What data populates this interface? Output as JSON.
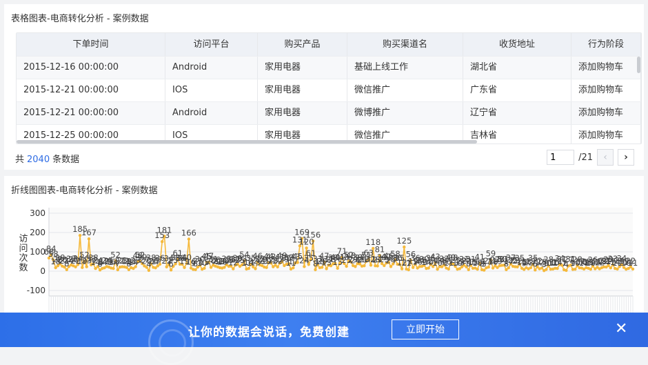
{
  "table_panel": {
    "title": "表格图表-电商转化分析 - 案例数据",
    "columns": [
      "下单时间",
      "访问平台",
      "购买产品",
      "购买渠道名",
      "收货地址",
      "行为阶段"
    ],
    "rows": [
      [
        "2015-12-16 00:00:00",
        "Android",
        "家用电器",
        "基础上线工作",
        "湖北省",
        "添加购物车"
      ],
      [
        "2015-12-21 00:00:00",
        "IOS",
        "家用电器",
        "微信推广",
        "广东省",
        "添加购物车"
      ],
      [
        "2015-12-21 00:00:00",
        "Android",
        "家用电器",
        "微博推广",
        "辽宁省",
        "添加购物车"
      ],
      [
        "2015-12-25 00:00:00",
        "IOS",
        "家用电器",
        "微信推广",
        "吉林省",
        "添加购物车"
      ]
    ],
    "footer": {
      "prefix": "共",
      "count": "2040",
      "suffix": "条数据"
    },
    "pager": {
      "current": "1",
      "total": "/21",
      "prev_icon": "chevron-left-icon",
      "next_icon": "chevron-right-icon"
    }
  },
  "chart_panel": {
    "title": "折线图图表-电商转化分析 - 案例数据"
  },
  "chart_data": {
    "type": "line",
    "ylabel": "访问次数",
    "xlabel": "",
    "ylim": [
      -100,
      300
    ],
    "yticks": [
      "300",
      "200",
      "100",
      "0",
      "-100"
    ],
    "grid": true,
    "series": [
      {
        "color": "#f5b93b",
        "values": [
          68,
          84,
          58,
          18,
          28,
          38,
          26,
          21,
          8,
          24,
          32,
          28,
          22,
          34,
          185,
          19,
          52,
          23,
          167,
          33,
          38,
          14,
          24,
          6,
          14,
          17,
          24,
          21,
          16,
          14,
          52,
          7,
          21,
          23,
          22,
          19,
          8,
          18,
          14,
          23,
          48,
          52,
          39,
          27,
          20,
          4,
          38,
          20,
          17,
          27,
          36,
          153,
          181,
          22,
          34,
          6,
          25,
          38,
          61,
          36,
          36,
          19,
          40,
          166,
          16,
          9,
          8,
          21,
          30,
          10,
          15,
          45,
          47,
          20,
          31,
          26,
          22,
          18,
          16,
          20,
          33,
          25,
          26,
          12,
          31,
          36,
          25,
          33,
          54,
          11,
          14,
          35,
          22,
          13,
          46,
          32,
          29,
          21,
          19,
          44,
          42,
          23,
          31,
          22,
          41,
          49,
          29,
          36,
          39,
          11,
          17,
          43,
          45,
          131,
          169,
          24,
          120,
          35,
          61,
          156,
          8,
          33,
          18,
          20,
          47,
          13,
          31,
          28,
          38,
          40,
          15,
          41,
          71,
          40,
          25,
          52,
          48,
          29,
          24,
          39,
          37,
          26,
          28,
          51,
          63,
          31,
          118,
          28,
          27,
          81,
          39,
          29,
          42,
          46,
          24,
          38,
          58,
          36,
          35,
          12,
          125,
          11,
          7,
          56,
          19,
          36,
          16,
          24,
          25,
          30,
          14,
          16,
          35,
          24,
          43,
          10,
          24,
          23,
          32,
          16,
          11,
          40,
          38,
          25,
          10,
          13,
          22,
          31,
          22,
          8,
          31,
          15,
          16,
          10,
          41,
          8,
          5,
          17,
          21,
          59,
          16,
          27,
          19,
          28,
          30,
          31,
          8,
          17,
          37,
          25,
          23,
          22,
          35,
          15,
          9,
          18,
          12,
          18,
          35,
          6,
          22,
          12,
          16,
          3,
          9,
          28,
          10,
          11,
          15,
          14,
          34,
          31,
          7,
          4,
          27,
          31,
          9,
          10,
          28,
          17,
          16,
          11,
          18,
          15,
          10,
          26,
          12,
          20,
          12,
          18,
          22,
          21,
          29,
          17,
          33,
          14,
          11,
          24,
          34,
          19,
          10,
          14,
          22,
          11
        ]
      }
    ],
    "labels": [
      "68",
      "84",
      "58",
      "18",
      "28",
      "38",
      "26",
      "21",
      "8",
      "24",
      "32",
      "28",
      "22",
      "34",
      "185",
      "19",
      "52",
      "23",
      "167",
      "33",
      "38",
      "14",
      "24",
      "6",
      "14",
      "17",
      "24",
      "21",
      "16",
      "14",
      "52",
      "7",
      "21",
      "23",
      "22",
      "19",
      "8",
      "18",
      "14",
      "23",
      "48",
      "52",
      "39",
      "27",
      "20",
      "4",
      "38",
      "20",
      "17",
      "27",
      "36",
      "153",
      "181",
      "22",
      "34",
      "6",
      "25",
      "38",
      "61",
      "36",
      "36",
      "19",
      "40",
      "166",
      "16",
      "9",
      "8",
      "21",
      "30",
      "10",
      "15",
      "45",
      "47",
      "20",
      "31",
      "26",
      "22",
      "18",
      "16",
      "20",
      "33",
      "25",
      "26",
      "12",
      "31",
      "36",
      "25",
      "33",
      "54",
      "11",
      "14",
      "35",
      "22",
      "13",
      "46",
      "32",
      "29",
      "21",
      "19",
      "44",
      "42",
      "23",
      "31",
      "22",
      "41",
      "49",
      "29",
      "36",
      "39",
      "11",
      "17",
      "43",
      "45",
      "131",
      "169",
      "24",
      "120",
      "35",
      "61",
      "156",
      "8",
      "33",
      "18",
      "20",
      "47",
      "13",
      "31",
      "28",
      "38",
      "40",
      "15",
      "41",
      "71",
      "40",
      "25",
      "52",
      "48",
      "29",
      "24",
      "39",
      "37",
      "26",
      "28",
      "51",
      "63",
      "31",
      "118",
      "28",
      "27",
      "81",
      "39",
      "29",
      "42",
      "46",
      "24",
      "38",
      "58",
      "36",
      "35",
      "12",
      "125",
      "11",
      "7",
      "56",
      "19",
      "36",
      "16",
      "24",
      "25",
      "30",
      "14",
      "16",
      "35",
      "24",
      "43",
      "10",
      "24",
      "23",
      "32",
      "16",
      "11",
      "40",
      "38",
      "25",
      "10",
      "13",
      "22",
      "31",
      "22",
      "8",
      "31",
      "15",
      "16",
      "10",
      "41",
      "8",
      "5",
      "17",
      "21",
      "59",
      "16",
      "27",
      "19",
      "28",
      "30",
      "31",
      "8",
      "17",
      "37",
      "25",
      "23",
      "22",
      "35",
      "15",
      "9",
      "18",
      "12",
      "18",
      "35",
      "6",
      "22",
      "12",
      "16",
      "3",
      "9",
      "28",
      "10",
      "11",
      "15",
      "14",
      "34",
      "31",
      "7",
      "4",
      "27",
      "31",
      "9",
      "10",
      "28",
      "17",
      "16",
      "11",
      "18",
      "15",
      "10",
      "26",
      "12",
      "20",
      "12",
      "18",
      "22",
      "21",
      "29",
      "17",
      "33",
      "14",
      "11",
      "24",
      "34",
      "19",
      "10",
      "14",
      "22",
      "11"
    ]
  },
  "banner": {
    "slogan": "让你的数据会说话，免费创建",
    "cta": "立即开始",
    "close_icon": "close-icon",
    "close_glyph": "✕"
  },
  "colors": {
    "accent": "#2d6be4",
    "line": "#f5b93b",
    "banner": "#3e7ff0"
  }
}
